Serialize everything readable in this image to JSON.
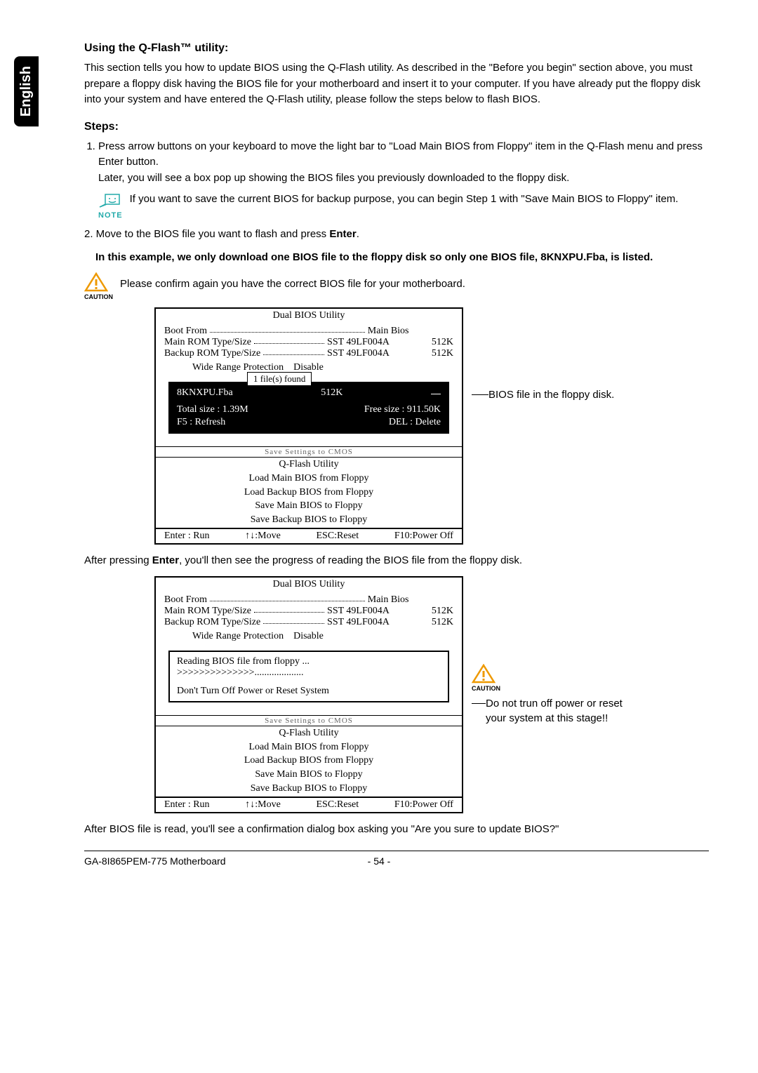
{
  "tab": "English",
  "h1": "Using the Q-Flash™ utility:",
  "intro": "This section tells you how to update BIOS using the Q-Flash utility. As described in the \"Before you begin\" section above, you must prepare a floppy disk having the BIOS file for your motherboard and insert it to your computer. If you have already put the floppy disk into your system and have entered the Q-Flash utility, please follow the steps below to flash BIOS.",
  "stepsHeading": "Steps:",
  "step1a": "Press arrow buttons on your keyboard to move the light bar to \"Load Main BIOS from Floppy\" item in the Q-Flash menu and press Enter button.",
  "step1b": "Later, you will see a box pop up showing the BIOS files you previously downloaded to the floppy disk.",
  "noteLabel": "NOTE",
  "noteText": "If you want to save the current BIOS for backup purpose, you can begin Step 1 with \"Save Main BIOS to Floppy\" item.",
  "step2a": "2. Move to the BIOS file you want to flash and press ",
  "enter": "Enter",
  "step2b": ".",
  "step2bold": "In this example, we only download one BIOS file to the floppy disk so only one BIOS file, 8KNXPU.Fba, is listed.",
  "cautionLabel": "CAUTION",
  "confirmText": "Please confirm again you have the correct BIOS file for your motherboard.",
  "bios1": {
    "title": "Dual BIOS Utility",
    "bootFrom": "Boot From",
    "bootFromVal": "Main Bios",
    "mainRom": "Main ROM Type/Size",
    "mainRomVal": "SST 49LF004A",
    "mainRomSz": "512K",
    "backupRom": "Backup ROM Type/Size",
    "backupRomVal": "SST 49LF004A",
    "backupRomSz": "512K",
    "wrp": "Wide Range Protection",
    "wrpVal": "Disable",
    "popup": "1 file(s) found",
    "filename": "8KNXPU.Fba",
    "filesize": "512K",
    "total": "Total size : 1.39M",
    "free": "Free size : 911.50K",
    "f5": "F5 : Refresh",
    "del": "DEL : Delete",
    "stripe": "Save Settings to CMOS",
    "qflash": "Q-Flash Utility",
    "items": [
      "Load Main BIOS from Floppy",
      "Load Backup BIOS from Floppy",
      "Save Main BIOS to Floppy",
      "Save Backup BIOS to Floppy"
    ],
    "foot": [
      "Enter : Run",
      "↑↓:Move",
      "ESC:Reset",
      "F10:Power Off"
    ]
  },
  "annot1": "BIOS file in the floppy disk.",
  "afterEnter1": "After pressing ",
  "afterEnter2": ", you'll then see the progress of reading the BIOS file from the floppy disk.",
  "bios2": {
    "reading": "Reading BIOS file from floppy ...",
    "progress": ">>>>>>>>>>>>>>....................",
    "dont": "Don't Turn Off Power or Reset System"
  },
  "annot2": "Do not trun off power or reset your system at this stage!!",
  "afterRead": "After BIOS file is read, you'll see a confirmation dialog box asking you \"Are you sure to update BIOS?\"",
  "footerLeft": "GA-8I865PEM-775 Motherboard",
  "footerPage": "- 54 -"
}
